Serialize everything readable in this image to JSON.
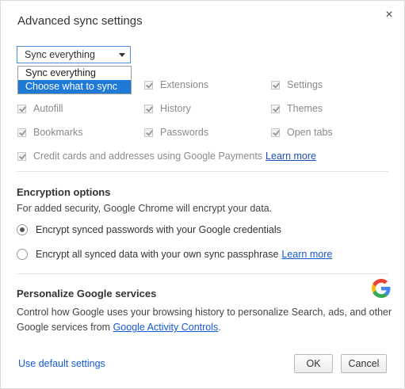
{
  "dialog": {
    "title": "Advanced sync settings",
    "close_glyph": "×"
  },
  "sync_select": {
    "value": "Sync everything",
    "options": [
      "Sync everything",
      "Choose what to sync"
    ],
    "highlighted_option": "Choose what to sync"
  },
  "data_types": {
    "extensions": "Extensions",
    "settings": "Settings",
    "autofill": "Autofill",
    "history": "History",
    "themes": "Themes",
    "bookmarks": "Bookmarks",
    "passwords": "Passwords",
    "open_tabs": "Open tabs",
    "payments": "Credit cards and addresses using Google Payments",
    "payments_learn_more": "Learn more",
    "all_checked": true
  },
  "encryption": {
    "heading": "Encryption options",
    "description": "For added security, Google Chrome will encrypt your data.",
    "option_google": "Encrypt synced passwords with your Google credentials",
    "option_passphrase": "Encrypt all synced data with your own sync passphrase",
    "passphrase_learn_more": "Learn more",
    "selected": "google"
  },
  "personalize": {
    "heading": "Personalize Google services",
    "line1": "Control how Google uses your browsing history to personalize Search, ads, and other",
    "line2_prefix": "Google services from ",
    "line2_link": "Google Activity Controls",
    "line2_suffix": ".",
    "logo_icon": "google-g-icon"
  },
  "footer": {
    "default_settings_link": "Use default settings",
    "ok_label": "OK",
    "cancel_label": "Cancel"
  },
  "colors": {
    "link": "#1558d6",
    "menu_highlight": "#1e7ad6",
    "select_border": "#4c8fe0"
  }
}
